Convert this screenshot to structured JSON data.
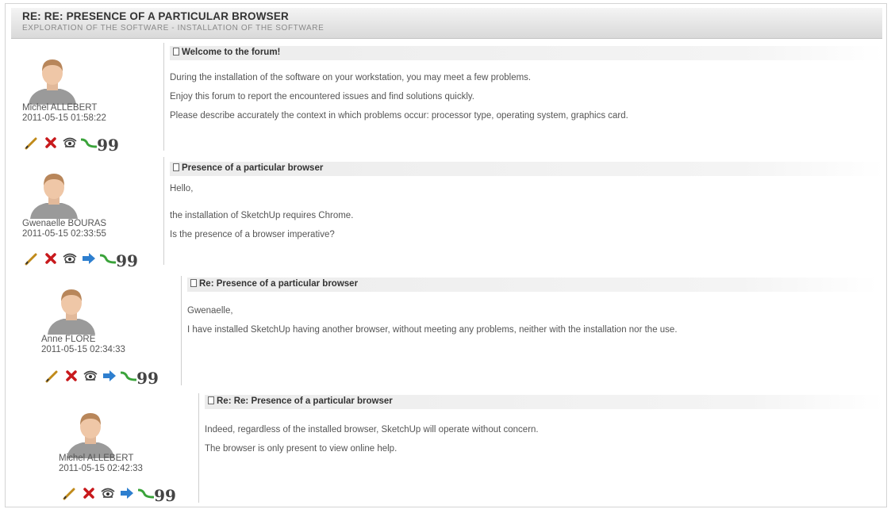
{
  "topic": {
    "title": "RE: RE: PRESENCE OF A PARTICULAR BROWSER",
    "breadcrumb": "EXPLORATION OF THE SOFTWARE - INSTALLATION OF THE SOFTWARE"
  },
  "posts": [
    {
      "author": "Michel ALLEBERT",
      "date": "2011-05-15 01:58:22",
      "subject": "Welcome to the forum!",
      "lines": [
        "During the installation of the software on your workstation, you may meet a few problems.",
        "Enjoy this forum to report the encountered issues and find solutions quickly.",
        "Please describe accurately the context in which problems occur: processor type, operating system, graphics card."
      ]
    },
    {
      "author": "Gwenaelle BOURAS",
      "date": "2011-05-15 02:33:55",
      "subject": "Presence of a particular browser",
      "lines": [
        "Hello,",
        "the installation of SketchUp requires Chrome.",
        "Is the presence of a browser imperative?"
      ]
    },
    {
      "author": "Anne FLORE",
      "date": "2011-05-15 02:34:33",
      "subject": "Re: Presence of a particular browser",
      "lines": [
        "Gwenaelle,",
        "I have installed SketchUp having another browser, without meeting any problems, neither with the installation nor the use."
      ]
    },
    {
      "author": "Michel ALLEBERT",
      "date": "2011-05-15 02:42:33",
      "subject": "Re: Re: Presence of a particular browser",
      "lines": [
        "Indeed, regardless of the installed browser, SketchUp will operate without concern.",
        "The browser is only present to view online help."
      ]
    }
  ],
  "actions": {
    "quote_glyph": "99",
    "icons": [
      "edit-icon",
      "delete-icon",
      "view-icon",
      "reply-icon",
      "split-icon",
      "quote-icon"
    ]
  },
  "colors": {
    "edit": "#c08a1a",
    "delete": "#c8191c",
    "reply": "#2e7fcf",
    "split": "#3aa33a"
  }
}
